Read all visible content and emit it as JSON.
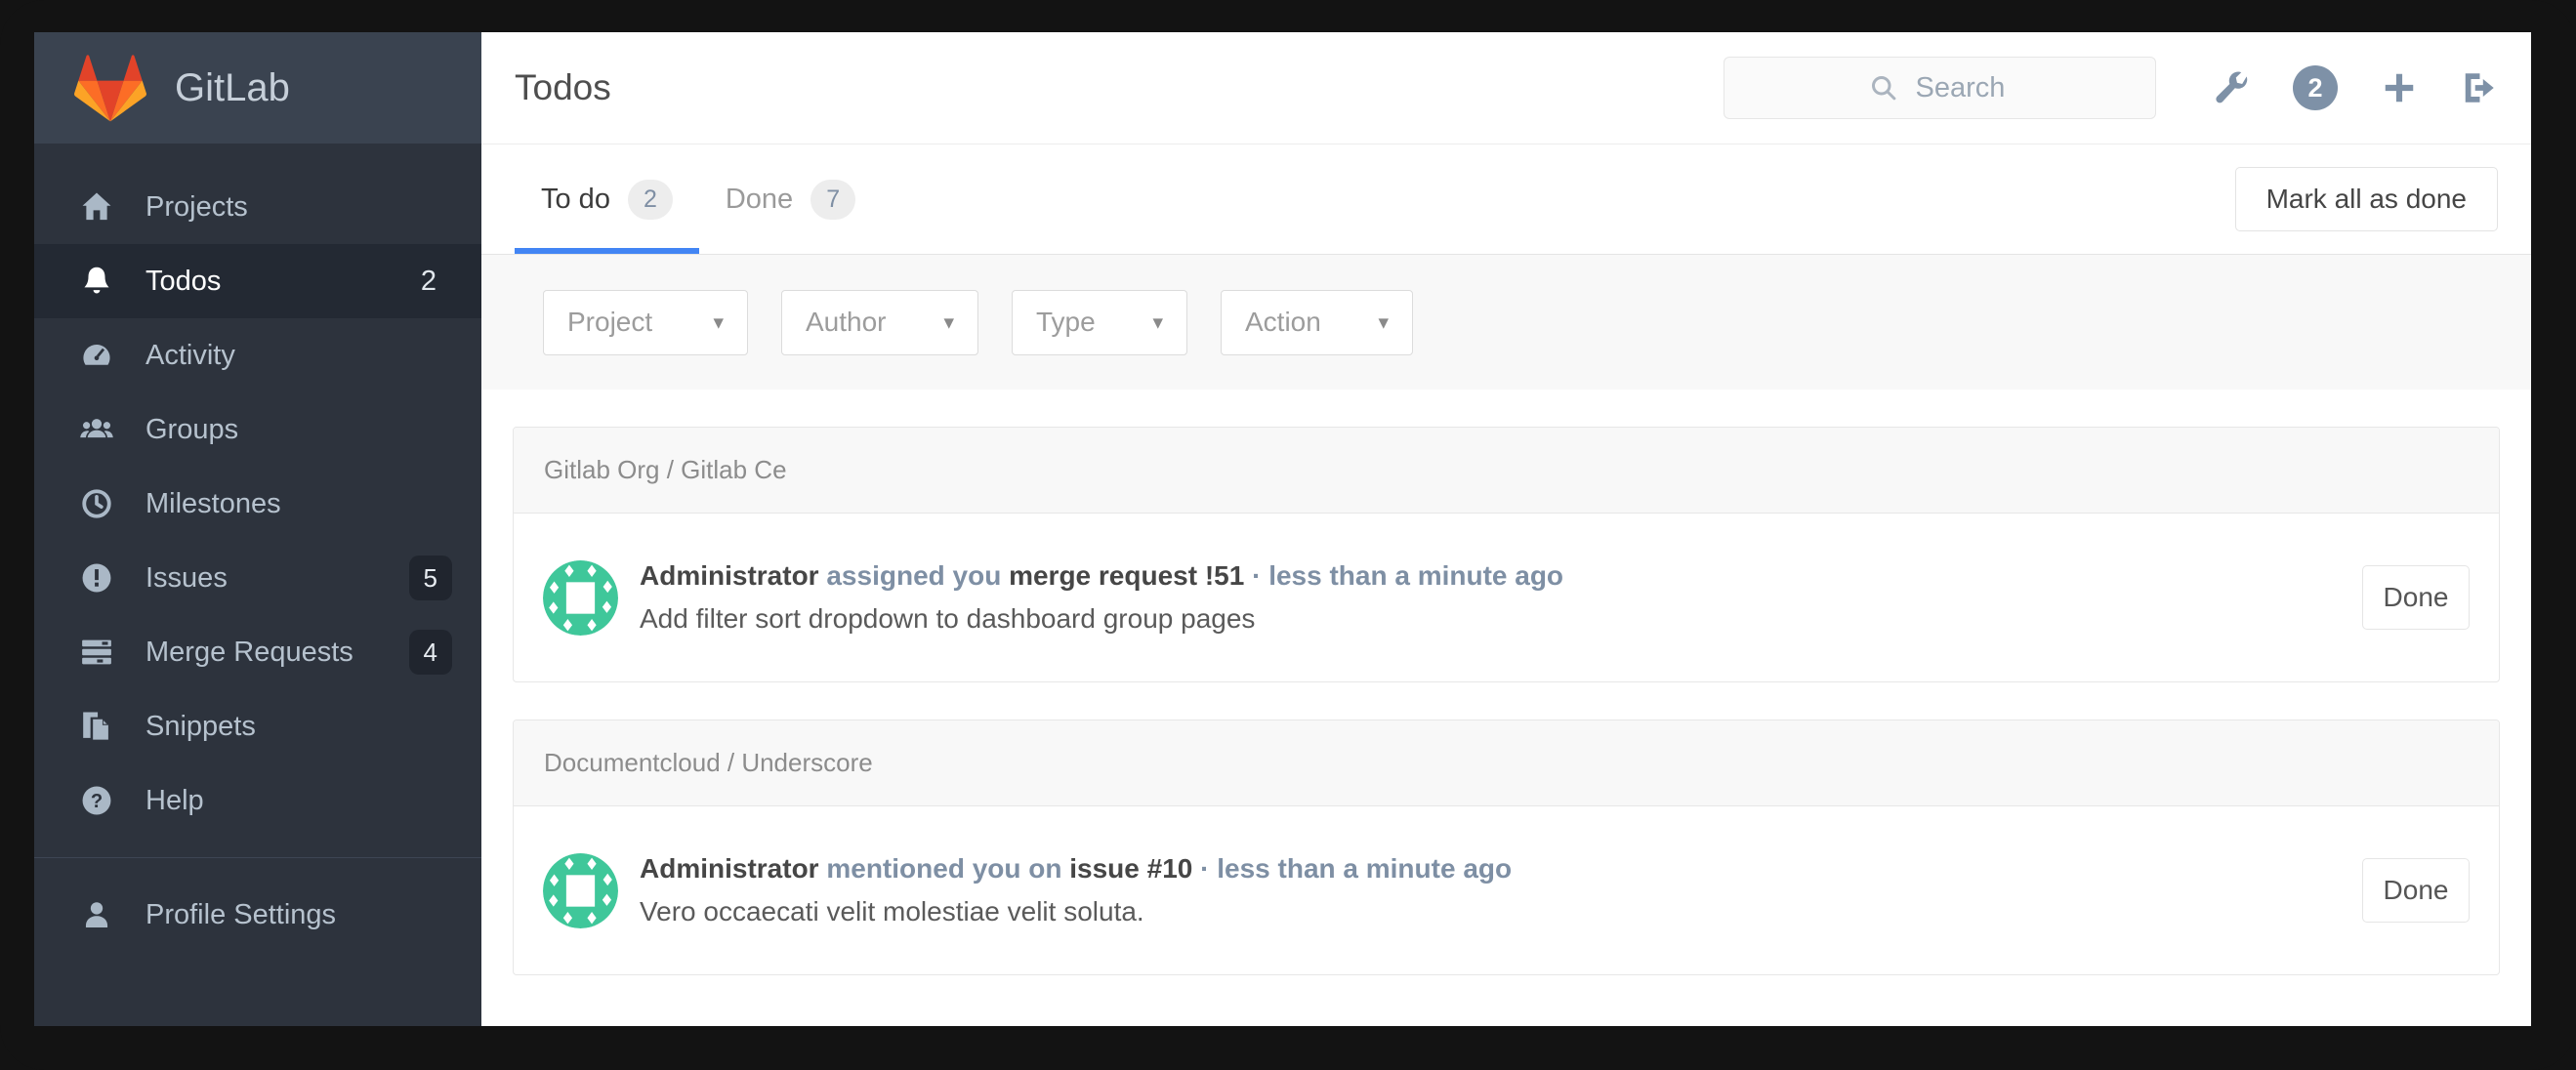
{
  "brand": {
    "name": "GitLab"
  },
  "sidebar": {
    "items": [
      {
        "label": "Projects",
        "icon": "home-icon"
      },
      {
        "label": "Todos",
        "icon": "bell-icon",
        "count": "2",
        "active": true
      },
      {
        "label": "Activity",
        "icon": "dashboard-icon"
      },
      {
        "label": "Groups",
        "icon": "users-icon"
      },
      {
        "label": "Milestones",
        "icon": "clock-icon"
      },
      {
        "label": "Issues",
        "icon": "issue-icon",
        "count": "5"
      },
      {
        "label": "Merge Requests",
        "icon": "merge-request-icon",
        "count": "4"
      },
      {
        "label": "Snippets",
        "icon": "snippet-icon"
      },
      {
        "label": "Help",
        "icon": "help-icon"
      }
    ],
    "footer_items": [
      {
        "label": "Profile Settings",
        "icon": "user-icon"
      }
    ]
  },
  "header": {
    "title": "Todos",
    "search_placeholder": "Search",
    "notification_count": "2"
  },
  "tabs": [
    {
      "label": "To do",
      "count": "2",
      "active": true
    },
    {
      "label": "Done",
      "count": "7",
      "active": false
    }
  ],
  "actions": {
    "mark_all_label": "Mark all as done"
  },
  "filters": [
    {
      "label": "Project",
      "caret": "▾"
    },
    {
      "label": "Author",
      "caret": "▾"
    },
    {
      "label": "Type",
      "caret": "▾"
    },
    {
      "label": "Action",
      "caret": "▾"
    }
  ],
  "groups": [
    {
      "name": "Gitlab Org / Gitlab Ce",
      "todos": [
        {
          "author": "Administrator",
          "action": "assigned you",
          "target": "merge request !51",
          "dot": "·",
          "time": "less than a minute ago",
          "body": "Add filter sort dropdown to dashboard group pages",
          "button_label": "Done"
        }
      ]
    },
    {
      "name": "Documentcloud / Underscore",
      "todos": [
        {
          "author": "Administrator",
          "action": "mentioned you on",
          "target": "issue #10",
          "dot": "·",
          "time": "less than a minute ago",
          "body": "Vero occaecati velit molestiae velit soluta.",
          "button_label": "Done"
        }
      ]
    }
  ],
  "colors": {
    "accent_blue": "#4285f4",
    "slate": "#7e8fa4",
    "avatar_green": "#3fc79a",
    "sidebar_bg": "#2d333d",
    "sidebar_header_bg": "#3a4350",
    "sidebar_active_bg": "#232933",
    "logo_red": "#e24329",
    "logo_orange": "#fc6d26",
    "logo_yellow": "#fca326"
  }
}
